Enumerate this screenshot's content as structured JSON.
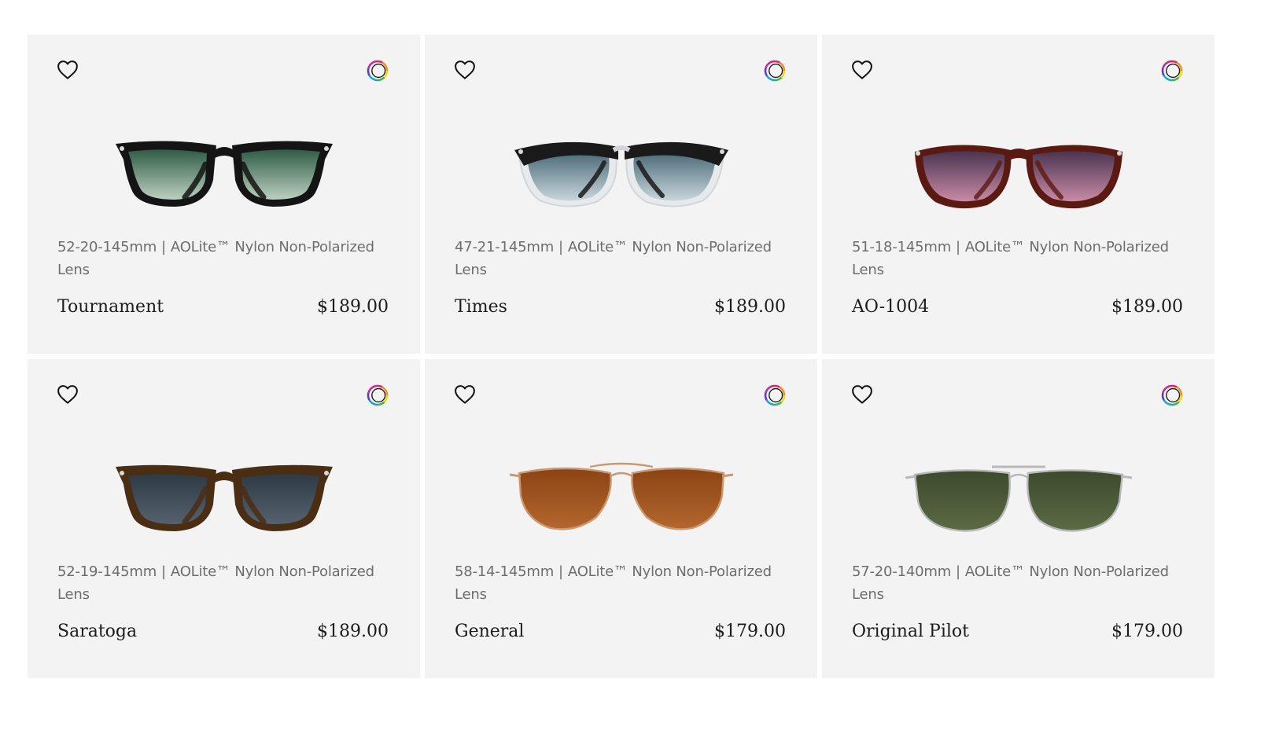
{
  "products": [
    {
      "specs_size": "52-20-145mm",
      "specs_separator": "|",
      "specs_lens": "AOLite™ Nylon Non-Polarized Lens",
      "name": "Tournament",
      "price": "$189.00",
      "frame_style": "wayfarer",
      "frame_color": "#141414",
      "lens_top_color": "#2f5c45",
      "lens_bottom_color": "#bcd0c0"
    },
    {
      "specs_size": "47-21-145mm",
      "specs_separator": "|",
      "specs_lens": "AOLite™ Nylon Non-Polarized Lens",
      "name": "Times",
      "price": "$189.00",
      "frame_style": "browline",
      "frame_color": "#1a1a1a",
      "lens_top_color": "#4b6b78",
      "lens_bottom_color": "#c9d6dc"
    },
    {
      "specs_size": "51-18-145mm",
      "specs_separator": "|",
      "specs_lens": "AOLite™ Nylon Non-Polarized Lens",
      "name": "AO-1004",
      "price": "$189.00",
      "frame_style": "round",
      "frame_color": "#5a1a12",
      "lens_top_color": "#4a3550",
      "lens_bottom_color": "#c98aa6"
    },
    {
      "specs_size": "52-19-145mm",
      "specs_separator": "|",
      "specs_lens": "AOLite™ Nylon Non-Polarized Lens",
      "name": "Saratoga",
      "price": "$189.00",
      "frame_style": "cateye",
      "frame_color": "#4a2e14",
      "lens_top_color": "#2e3a44",
      "lens_bottom_color": "#55616c"
    },
    {
      "specs_size": "58-14-145mm",
      "specs_separator": "|",
      "specs_lens": "AOLite™ Nylon Non-Polarized Lens",
      "name": "General",
      "price": "$179.00",
      "frame_style": "aviator",
      "frame_color": "#c99a72",
      "lens_top_color": "#8c4415",
      "lens_bottom_color": "#b4672e"
    },
    {
      "specs_size": "57-20-140mm",
      "specs_separator": "|",
      "specs_lens": "AOLite™ Nylon Non-Polarized Lens",
      "name": "Original Pilot",
      "price": "$179.00",
      "frame_style": "pilot",
      "frame_color": "#b8b8b8",
      "lens_top_color": "#3b4a2c",
      "lens_bottom_color": "#5b6b45"
    }
  ],
  "icons": {
    "favorite": "heart-outline-icon",
    "color_options": "color-ring-icon"
  },
  "colors": {
    "card_background": "#f3f3f3",
    "text_primary": "#1c1c1c",
    "text_secondary": "#6d6d6d"
  }
}
